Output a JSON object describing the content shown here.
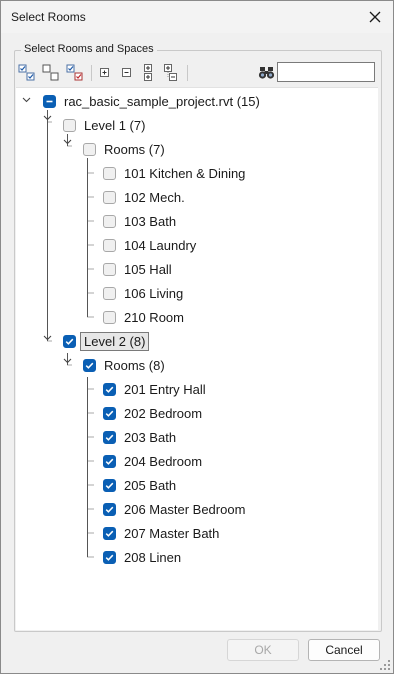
{
  "window": {
    "title": "Select Rooms"
  },
  "group": {
    "label": "Select Rooms and Spaces"
  },
  "toolbar": {
    "buttons": [
      "check-all-icon",
      "uncheck-all-icon",
      "toggle-check-icon",
      "expand-icon",
      "collapse-icon",
      "expand-all-icon",
      "collapse-all-icon"
    ],
    "search_icon": "binoculars-icon",
    "search_value": ""
  },
  "tree": {
    "root": {
      "label": "rac_basic_sample_project.rvt (15)",
      "state": "indeterminate"
    },
    "levels": [
      {
        "label": "Level 1 (7)",
        "state": "unchecked",
        "group": {
          "label": "Rooms (7)",
          "state": "unchecked"
        },
        "rooms": [
          "101 Kitchen & Dining",
          "102 Mech.",
          "103 Bath",
          "104 Laundry",
          "105 Hall",
          "106 Living",
          "210 Room"
        ]
      },
      {
        "label": "Level 2 (8)",
        "state": "checked",
        "selected": true,
        "group": {
          "label": "Rooms (8)",
          "state": "checked"
        },
        "rooms": [
          "201 Entry Hall",
          "202 Bedroom",
          "203 Bath",
          "204 Bedroom",
          "205 Bath",
          "206 Master Bedroom",
          "207 Master Bath",
          "208 Linen"
        ]
      }
    ]
  },
  "footer": {
    "ok_label": "OK",
    "ok_enabled": false,
    "cancel_label": "Cancel"
  },
  "colors": {
    "accent": "#0a5fb4",
    "background": "#f0f0f0",
    "tree_background": "#ffffff"
  }
}
